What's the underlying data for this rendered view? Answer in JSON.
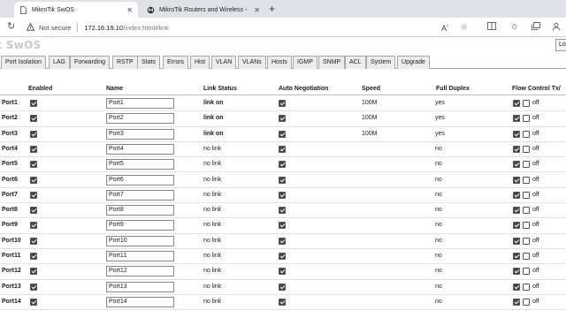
{
  "browser": {
    "tabs": [
      {
        "title": "MikroTik SwOS",
        "active": true
      },
      {
        "title": "MikroTik Routers and Wireless -",
        "active": false
      }
    ],
    "address": {
      "security_label": "Not secure",
      "host": "172.16.19.10",
      "path": "/index.html#link"
    }
  },
  "app": {
    "logo": "k SwOS",
    "logout_label": "Lo"
  },
  "menu": [
    "Port Isolation",
    "LAG",
    "Forwarding",
    "RSTP",
    "Stats",
    "Errors",
    "Hist",
    "VLAN",
    "VLANs",
    "Hosts",
    "IGMP",
    "SNMP",
    "ACL",
    "System",
    "Upgrade"
  ],
  "table": {
    "columns": {
      "enabled": "Enabled",
      "name": "Name",
      "link_status": "Link Status",
      "auto_negotiation": "Auto Negotiation",
      "speed": "Speed",
      "full_duplex": "Full Duplex",
      "flow_control": "Flow Control Tx/"
    },
    "rows": [
      {
        "port": "Port1",
        "enabled": true,
        "name": "Port1",
        "status": "link on",
        "link_up": true,
        "auto_neg": true,
        "speed": "100M",
        "duplex": "yes",
        "fc_tx": true,
        "fc_rx": false,
        "fc_label": "off"
      },
      {
        "port": "Port2",
        "enabled": true,
        "name": "Port2",
        "status": "link on",
        "link_up": true,
        "auto_neg": true,
        "speed": "100M",
        "duplex": "yes",
        "fc_tx": true,
        "fc_rx": false,
        "fc_label": "off"
      },
      {
        "port": "Port3",
        "enabled": true,
        "name": "Port3",
        "status": "link on",
        "link_up": true,
        "auto_neg": true,
        "speed": "100M",
        "duplex": "yes",
        "fc_tx": true,
        "fc_rx": false,
        "fc_label": "off"
      },
      {
        "port": "Port4",
        "enabled": true,
        "name": "Port4",
        "status": "no link",
        "link_up": false,
        "auto_neg": true,
        "speed": "",
        "duplex": "no",
        "fc_tx": true,
        "fc_rx": false,
        "fc_label": "off"
      },
      {
        "port": "Port5",
        "enabled": true,
        "name": "Port5",
        "status": "no link",
        "link_up": false,
        "auto_neg": true,
        "speed": "",
        "duplex": "no",
        "fc_tx": true,
        "fc_rx": false,
        "fc_label": "off"
      },
      {
        "port": "Port6",
        "enabled": true,
        "name": "Port6",
        "status": "no link",
        "link_up": false,
        "auto_neg": true,
        "speed": "",
        "duplex": "no",
        "fc_tx": true,
        "fc_rx": false,
        "fc_label": "off"
      },
      {
        "port": "Port7",
        "enabled": true,
        "name": "Port7",
        "status": "no link",
        "link_up": false,
        "auto_neg": true,
        "speed": "",
        "duplex": "no",
        "fc_tx": true,
        "fc_rx": false,
        "fc_label": "off"
      },
      {
        "port": "Port8",
        "enabled": true,
        "name": "Port8",
        "status": "no link",
        "link_up": false,
        "auto_neg": true,
        "speed": "",
        "duplex": "no",
        "fc_tx": true,
        "fc_rx": false,
        "fc_label": "off"
      },
      {
        "port": "Port9",
        "enabled": true,
        "name": "Port9",
        "status": "no link",
        "link_up": false,
        "auto_neg": true,
        "speed": "",
        "duplex": "no",
        "fc_tx": true,
        "fc_rx": false,
        "fc_label": "off"
      },
      {
        "port": "Port10",
        "enabled": true,
        "name": "Port10",
        "status": "no link",
        "link_up": false,
        "auto_neg": true,
        "speed": "",
        "duplex": "no",
        "fc_tx": true,
        "fc_rx": false,
        "fc_label": "off"
      },
      {
        "port": "Port11",
        "enabled": true,
        "name": "Port11",
        "status": "no link",
        "link_up": false,
        "auto_neg": true,
        "speed": "",
        "duplex": "no",
        "fc_tx": true,
        "fc_rx": false,
        "fc_label": "off"
      },
      {
        "port": "Port12",
        "enabled": true,
        "name": "Port12",
        "status": "no link",
        "link_up": false,
        "auto_neg": true,
        "speed": "",
        "duplex": "no",
        "fc_tx": true,
        "fc_rx": false,
        "fc_label": "off"
      },
      {
        "port": "Port13",
        "enabled": true,
        "name": "Port13",
        "status": "no link",
        "link_up": false,
        "auto_neg": true,
        "speed": "",
        "duplex": "no",
        "fc_tx": true,
        "fc_rx": false,
        "fc_label": "off"
      },
      {
        "port": "Port14",
        "enabled": true,
        "name": "Port14",
        "status": "no link",
        "link_up": false,
        "auto_neg": true,
        "speed": "",
        "duplex": "no",
        "fc_tx": true,
        "fc_rx": false,
        "fc_label": "off"
      }
    ]
  }
}
